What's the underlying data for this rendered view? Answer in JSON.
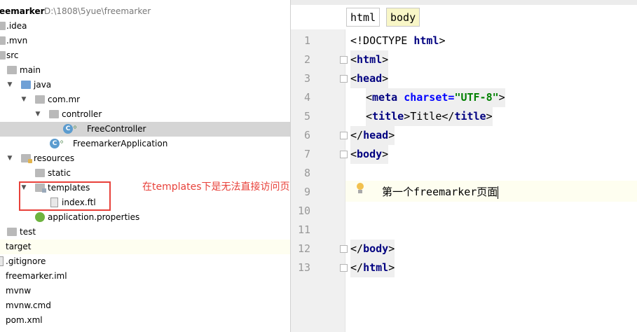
{
  "project": {
    "name": "eemarker",
    "path": "D:\\1808\\5yue\\freemarker"
  },
  "tree": [
    {
      "label": ".idea"
    },
    {
      "label": ".mvn"
    },
    {
      "label": "src"
    },
    {
      "label": "main"
    },
    {
      "label": "java"
    },
    {
      "label": "com.mr"
    },
    {
      "label": "controller"
    },
    {
      "label": "FreeController"
    },
    {
      "label": "FreemarkerApplication"
    },
    {
      "label": "resources"
    },
    {
      "label": "static"
    },
    {
      "label": "templates"
    },
    {
      "label": "index.ftl"
    },
    {
      "label": "application.properties"
    },
    {
      "label": "test"
    },
    {
      "label": "target"
    },
    {
      "label": ".gitignore"
    },
    {
      "label": "freemarker.iml"
    },
    {
      "label": "mvnw"
    },
    {
      "label": "mvnw.cmd"
    },
    {
      "label": "pom.xml"
    }
  ],
  "annotation": "在templates下是无法直接访问页面",
  "breadcrumbs": [
    "html",
    "body"
  ],
  "lines": [
    "1",
    "2",
    "3",
    "4",
    "5",
    "6",
    "7",
    "8",
    "9",
    "10",
    "11",
    "12",
    "13"
  ],
  "code": {
    "l1_a": "<!DOCTYPE ",
    "l1_b": "html",
    "l1_c": ">",
    "l2_a": "<",
    "l2_b": "html",
    "l2_c": ">",
    "l3_a": "<",
    "l3_b": "head",
    "l3_c": ">",
    "l4_a": "<",
    "l4_b": "meta ",
    "l4_c": "charset=",
    "l4_d": "\"UTF-8\"",
    "l4_e": ">",
    "l5_a": "<",
    "l5_b": "title",
    "l5_c": ">Title</",
    "l5_d": "title",
    "l5_e": ">",
    "l6_a": "</",
    "l6_b": "head",
    "l6_c": ">",
    "l7_a": "<",
    "l7_b": "body",
    "l7_c": ">",
    "l9": "第一个freemarker页面",
    "l12_a": "</",
    "l12_b": "body",
    "l12_c": ">",
    "l13_a": "</",
    "l13_b": "html",
    "l13_c": ">"
  }
}
